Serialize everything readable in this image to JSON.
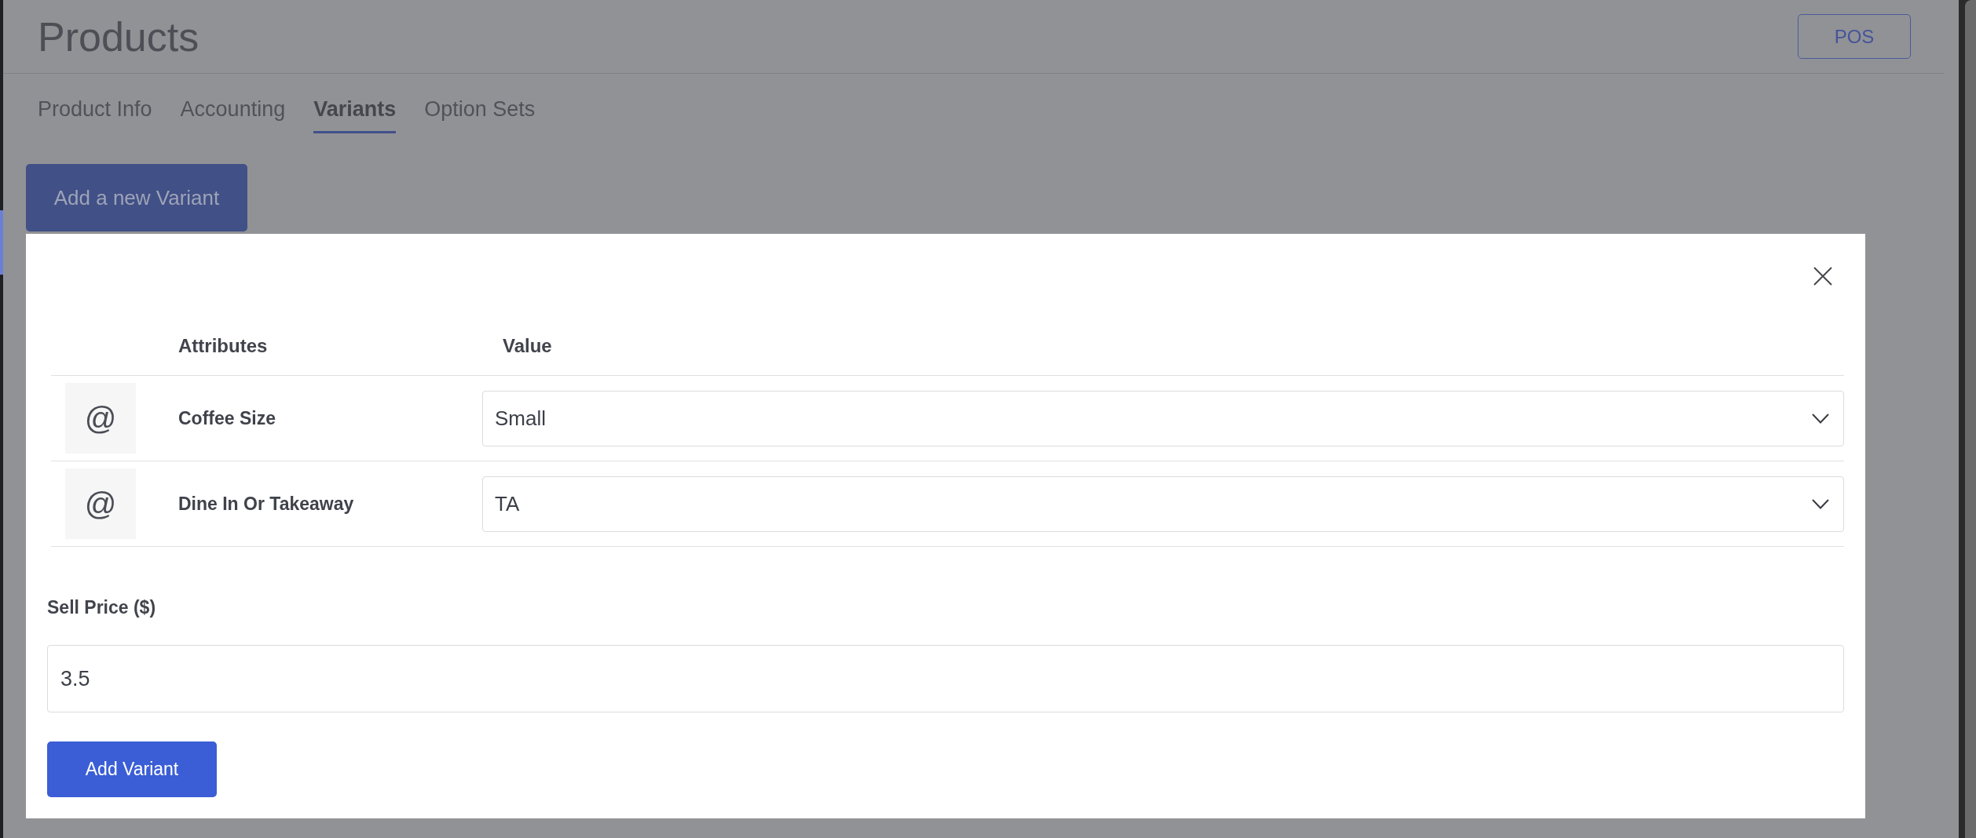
{
  "page": {
    "title": "Products",
    "pos_button": "POS"
  },
  "tabs": [
    {
      "label": "Product Info",
      "selected": false
    },
    {
      "label": "Accounting",
      "selected": false
    },
    {
      "label": "Variants",
      "selected": true
    },
    {
      "label": "Option Sets",
      "selected": false
    }
  ],
  "add_button": "Add a new Variant",
  "modal": {
    "columns": [
      "Attributes",
      "Value"
    ],
    "rows": [
      {
        "icon": "@",
        "attribute": "Coffee Size",
        "value": "Small"
      },
      {
        "icon": "@",
        "attribute": "Dine In Or Takeaway",
        "value": "TA"
      }
    ],
    "price_label": "Sell Price ($)",
    "price_value": "3.5",
    "submit_button": "Add Variant"
  }
}
